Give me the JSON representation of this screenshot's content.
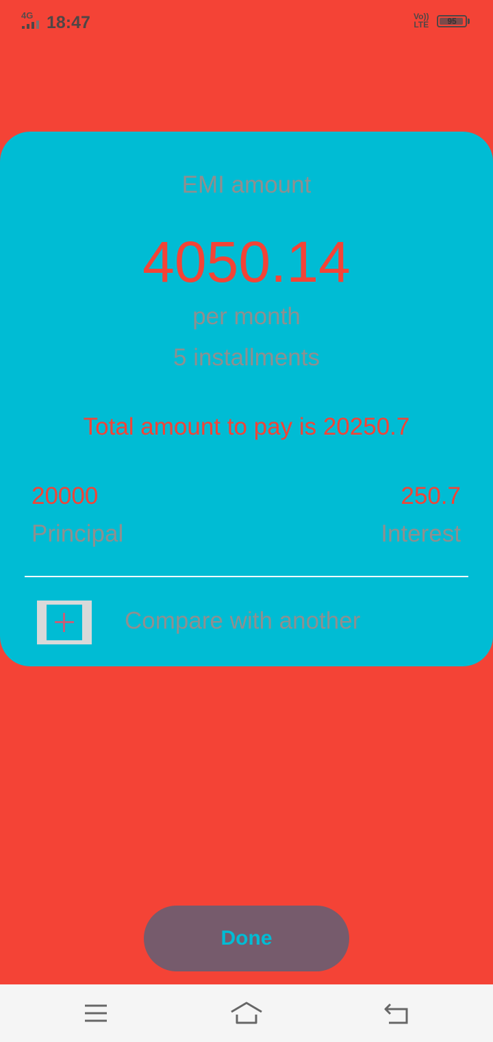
{
  "status_bar": {
    "network": "4G",
    "time": "18:47",
    "volte_top": "Vo))",
    "volte_bottom": "LTE",
    "battery_level": "95",
    "battery_fraction": 0.95
  },
  "card": {
    "emi_label": "EMI amount",
    "emi_value": "4050.14",
    "per_month": "per month",
    "installments": "5 installments",
    "total_text": "Total amount to pay is 20250.7",
    "principal_value": "20000",
    "principal_label": "Principal",
    "interest_value": "250.7",
    "interest_label": "Interest",
    "compare_label": "Compare with another",
    "add_icon": "plus-icon"
  },
  "done_button": {
    "label": "Done"
  },
  "nav_bar": {
    "icons": [
      "menu-icon",
      "home-icon",
      "back-icon"
    ]
  },
  "colors": {
    "background": "#f44336",
    "card": "#00bcd4",
    "accent": "#f44336",
    "muted_text": "#8f8f8f",
    "done_button": "#765b6c"
  }
}
